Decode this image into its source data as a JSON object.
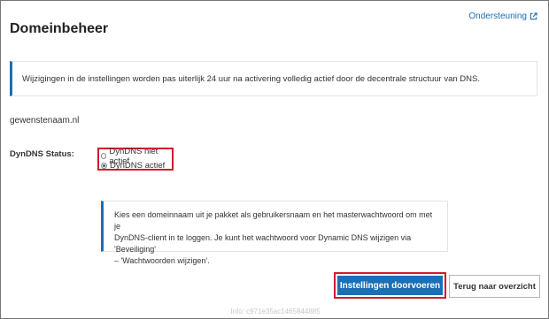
{
  "header": {
    "support_label": "Ondersteuning",
    "support_icon": "external-link-icon",
    "page_title": "Domeinbeheer"
  },
  "info_message": "Wijzigingen in de instellingen worden pas uiterlijk 24 uur na activering volledig actief door de decentrale structuur van DNS.",
  "domain_name": "gewenstenaam.nl",
  "dyndns": {
    "label": "DynDNS Status:",
    "options": [
      {
        "label": "DynDNS niet actief",
        "checked": false
      },
      {
        "label": "DynDNS actief",
        "checked": true
      }
    ]
  },
  "note_lines": [
    "Kies een domeinnaam uit je pakket als gebruikersnaam en het masterwachtwoord om met je",
    "DynDNS-client in te loggen. Je kunt het wachtwoord voor Dynamic DNS wijzigen via 'Beveiliging'",
    "– 'Wachtwoorden wijzigen'."
  ],
  "actions": {
    "apply_label": "Instellingen doorvoeren",
    "back_label": "Terug naar overzicht"
  },
  "footer_info": "Info: c971e35ac1465844885",
  "colors": {
    "accent": "#1a6fb5",
    "highlight_border": "#d01c2a"
  }
}
